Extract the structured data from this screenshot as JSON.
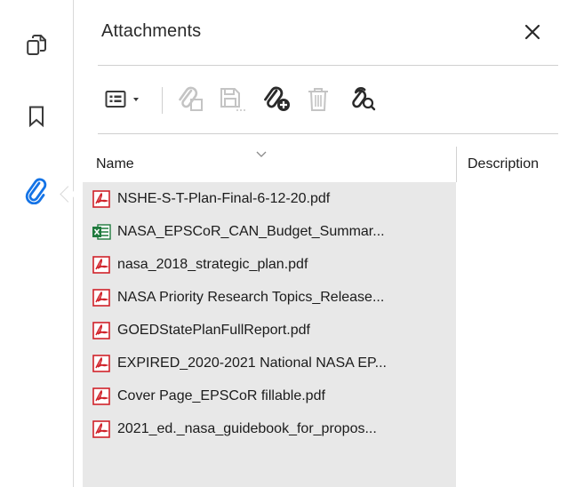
{
  "panel": {
    "title": "Attachments",
    "close_glyph": "✕"
  },
  "rail": {
    "items": [
      {
        "name": "pages",
        "icon": "copy-pages-icon",
        "active": false
      },
      {
        "name": "bookmarks",
        "icon": "bookmark-icon",
        "active": false
      },
      {
        "name": "attachments",
        "icon": "paperclip-icon",
        "active": true
      }
    ]
  },
  "toolbar": {
    "items": [
      {
        "icon": "list-options-icon",
        "enabled": true
      },
      {
        "icon": "open-attachment-icon",
        "enabled": false
      },
      {
        "icon": "save-attachment-icon",
        "enabled": false
      },
      {
        "icon": "add-attachment-icon",
        "enabled": true
      },
      {
        "icon": "delete-icon",
        "enabled": false
      },
      {
        "icon": "search-attachment-icon",
        "enabled": true
      }
    ]
  },
  "table": {
    "columns": [
      "Name",
      "Description"
    ],
    "files": [
      {
        "name": "NSHE-S-T-Plan-Final-6-12-20.pdf",
        "type": "pdf"
      },
      {
        "name": "NASA_EPSCoR_CAN_Budget_Summar...",
        "type": "excel"
      },
      {
        "name": "nasa_2018_strategic_plan.pdf",
        "type": "pdf"
      },
      {
        "name": "NASA Priority Research Topics_Release...",
        "type": "pdf"
      },
      {
        "name": "GOEDStatePlanFullReport.pdf",
        "type": "pdf"
      },
      {
        "name": "EXPIRED_2020-2021 National NASA EP...",
        "type": "pdf"
      },
      {
        "name": "Cover Page_EPSCoR fillable.pdf",
        "type": "pdf"
      },
      {
        "name": "2021_ed._nasa_guidebook_for_propos...",
        "type": "pdf"
      }
    ]
  },
  "colors": {
    "accent": "#1473e6",
    "pdf_red": "#d0222a",
    "excel_green": "#1f7a3d",
    "disabled": "#c4c4c4",
    "icon": "#3a3a3a",
    "list_bg": "#e8e8e8"
  }
}
